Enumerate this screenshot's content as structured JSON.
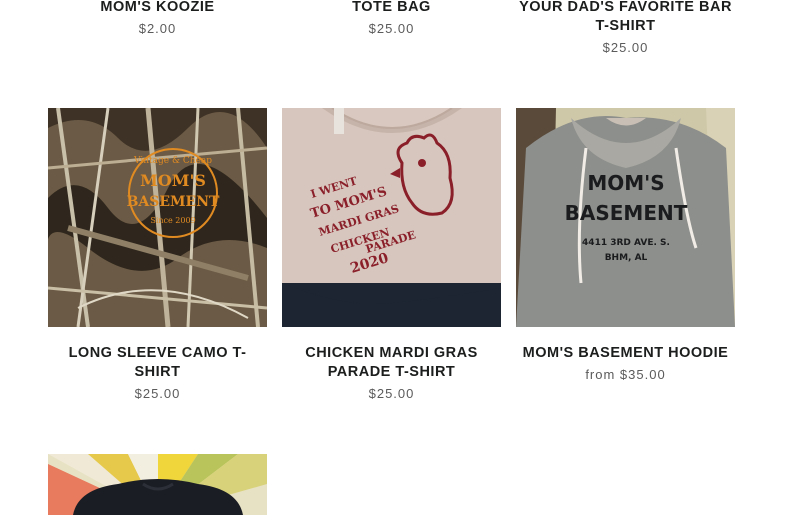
{
  "products_top": [
    {
      "title": "MOM'S KOOZIE",
      "price": "$2.00"
    },
    {
      "title": "TOTE BAG",
      "price": "$25.00"
    },
    {
      "title": "YOUR DAD'S FAVORITE BAR T-SHIRT",
      "price": "$25.00"
    }
  ],
  "products_mid": [
    {
      "title": "LONG SLEEVE CAMO T-SHIRT",
      "price": "$25.00",
      "image_text": [
        "Vintage & Cheap",
        "MOM'S",
        "BASEMENT",
        "Since 2009"
      ]
    },
    {
      "title": "CHICKEN MARDI GRAS PARADE T-SHIRT",
      "price": "$25.00",
      "image_text": [
        "I WENT",
        "TO MOM'S",
        "MARDI GRAS",
        "CHICKEN",
        "PARADE",
        "2020"
      ]
    },
    {
      "title": "MOM'S BASEMENT HOODIE",
      "price": "from $35.00",
      "image_text": [
        "MOM'S",
        "BASEMENT",
        "4411 3RD AVE. S.",
        "BHM, AL"
      ]
    }
  ]
}
